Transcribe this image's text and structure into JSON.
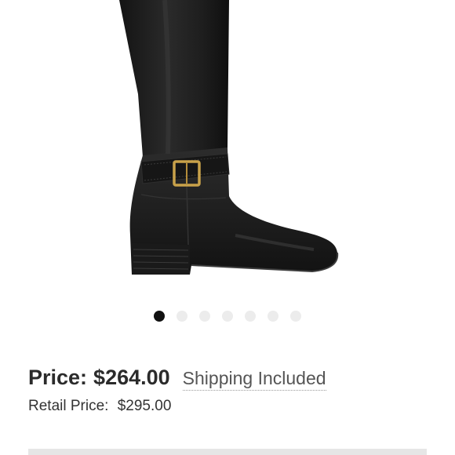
{
  "product": {
    "image_alt": "Black leather riding boot with gold buckle strap",
    "boot_color": "#1c1c1c",
    "buckle_color": "#c9a24a"
  },
  "carousel": {
    "total_images": 7,
    "active_index": 0,
    "active_color": "#111111",
    "inactive_color": "#ececec"
  },
  "pricing": {
    "price_label": "Price:",
    "price_value": "$264.00",
    "shipping_text": "Shipping Included",
    "retail_label": "Retail Price:",
    "retail_value": "$295.00"
  }
}
